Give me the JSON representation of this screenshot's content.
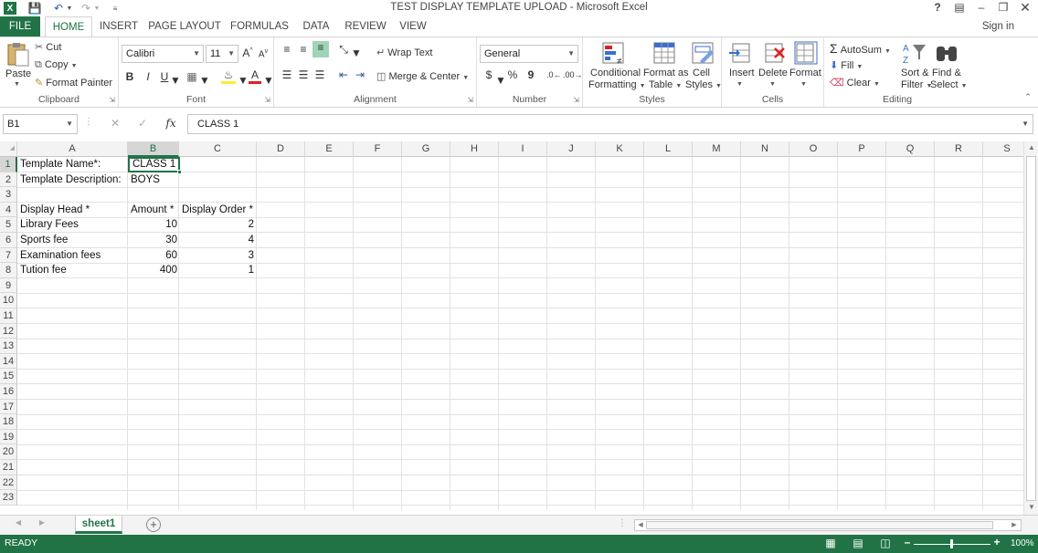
{
  "window": {
    "title": "TEST DISPLAY TEMPLATE UPLOAD - Microsoft Excel",
    "help": "?",
    "signin": "Sign in"
  },
  "tabs": [
    "FILE",
    "HOME",
    "INSERT",
    "PAGE LAYOUT",
    "FORMULAS",
    "DATA",
    "REVIEW",
    "VIEW"
  ],
  "clipboard": {
    "paste": "Paste",
    "cut": "Cut",
    "copy": "Copy",
    "format_painter": "Format Painter",
    "label": "Clipboard"
  },
  "font": {
    "family": "Calibri",
    "size": "11",
    "label": "Font",
    "bold": "B",
    "italic": "I",
    "underline": "U"
  },
  "alignment": {
    "wrap": "Wrap Text",
    "merge": "Merge & Center",
    "label": "Alignment"
  },
  "number": {
    "format": "General",
    "currency": "$",
    "percent": "%",
    "comma": "9",
    "label": "Number"
  },
  "styles": {
    "cond1": "Conditional",
    "cond2": "Formatting",
    "fmt1": "Format as",
    "fmt2": "Table",
    "cell1": "Cell",
    "cell2": "Styles",
    "label": "Styles"
  },
  "cells": {
    "insert": "Insert",
    "delete": "Delete",
    "format": "Format",
    "label": "Cells"
  },
  "editing": {
    "autosum": "AutoSum",
    "fill": "Fill",
    "clear": "Clear",
    "sort1": "Sort &",
    "sort2": "Filter",
    "find1": "Find &",
    "find2": "Select",
    "label": "Editing"
  },
  "formula_bar": {
    "name_box": "B1",
    "content": "CLASS 1",
    "fx": "fx"
  },
  "columns": [
    "A",
    "B",
    "C",
    "D",
    "E",
    "F",
    "G",
    "H",
    "I",
    "J",
    "K",
    "L",
    "M",
    "N",
    "O",
    "P",
    "Q",
    "R",
    "S"
  ],
  "rows": [
    "1",
    "2",
    "3",
    "4",
    "5",
    "6",
    "7",
    "8",
    "9",
    "10",
    "11",
    "12",
    "13",
    "14",
    "15",
    "16",
    "17",
    "18",
    "19",
    "20",
    "21",
    "22",
    "23"
  ],
  "cells_data": {
    "A1": "Template Name*:",
    "B1": "CLASS 1",
    "A2": "Template Description:",
    "B2": "BOYS",
    "A4": "Display Head *",
    "B4": "Amount *",
    "C4": "Display Order *",
    "A5": "Library Fees",
    "B5": "10",
    "C5": "2",
    "A6": "Sports fee",
    "B6": "30",
    "C6": "4",
    "A7": "Examination fees",
    "B7": "60",
    "C7": "3",
    "A8": "Tution fee",
    "B8": "400",
    "C8": "1"
  },
  "sheet": {
    "name": "sheet1"
  },
  "status": {
    "ready": "READY",
    "zoom": "100%"
  }
}
